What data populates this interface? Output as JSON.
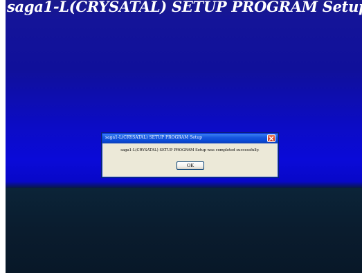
{
  "installer": {
    "title": "saga1-L(CRYSATAL) SETUP PROGRAM Setup"
  },
  "dialog": {
    "title": "saga1-L(CRYSATAL) SETUP PROGRAM Setup",
    "message": "saga1-L(CRYSATAL) SETUP PROGRAM Setup was completed successfully.",
    "ok_label": "OK",
    "close_icon": "close-icon"
  },
  "colors": {
    "backdrop_top": "#1a1a8c",
    "backdrop_mid": "#0a0ad8",
    "backdrop_lower": "#0a1c2e",
    "dialog_face": "#ece9d8",
    "titlebar": "#0a4bd8",
    "close_button": "#d9432b"
  }
}
